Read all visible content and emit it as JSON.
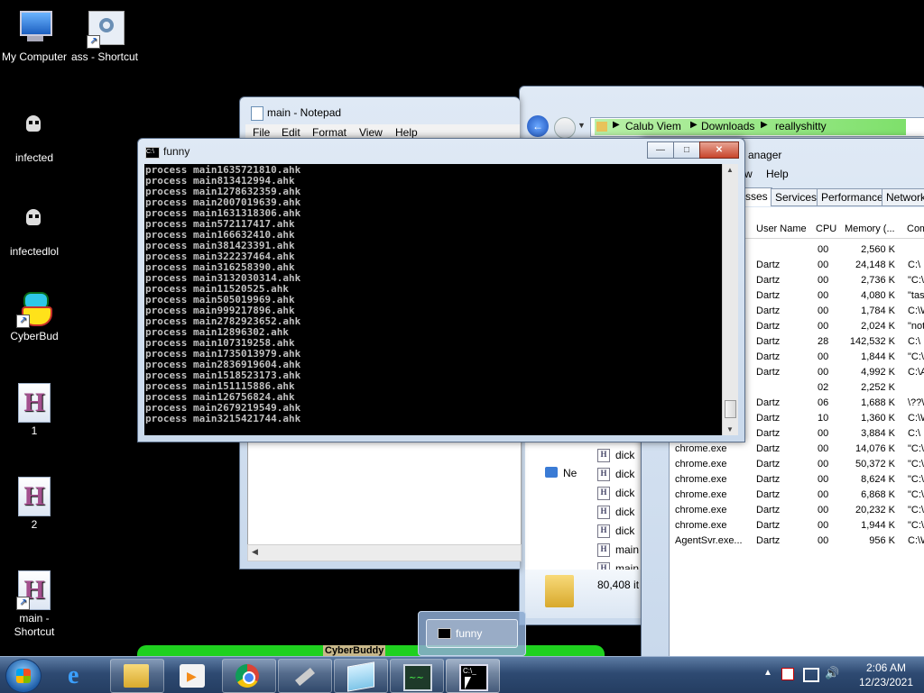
{
  "desktop": {
    "icons": [
      {
        "label": "My Computer"
      },
      {
        "label": "ass - Shortcut"
      },
      {
        "label": "infected"
      },
      {
        "label": "infectedlol"
      },
      {
        "label": "CyberBud"
      },
      {
        "label": "1"
      },
      {
        "label": "2"
      },
      {
        "label": "main - Shortcut"
      }
    ]
  },
  "notepad": {
    "title": "main - Notepad",
    "menu": [
      "File",
      "Edit",
      "Format",
      "View",
      "Help"
    ]
  },
  "explorer": {
    "breadcrumb": [
      "Calub Viem",
      "Downloads",
      "reallyshitty"
    ],
    "sidebar_network": "Ne",
    "files": [
      "dick",
      "dick",
      "dick",
      "dick",
      "dick",
      "main",
      "main"
    ],
    "status": "80,408 it"
  },
  "task_manager": {
    "title_fragment": "anager",
    "menu_fragment": [
      "w",
      "Help"
    ],
    "tabs": [
      "sses",
      "Services",
      "Performance",
      "Networki"
    ],
    "columns": [
      "User Name",
      "CPU",
      "Memory (...",
      "Com"
    ],
    "rows": [
      {
        "name": "",
        "user": "",
        "cpu": "00",
        "mem": "2,560 K",
        "cmd": ""
      },
      {
        "name": "",
        "user": "Dartz",
        "cpu": "00",
        "mem": "24,148 K",
        "cmd": "C:\\"
      },
      {
        "name": "",
        "user": "Dartz",
        "cpu": "00",
        "mem": "2,736 K",
        "cmd": "\"C:\\"
      },
      {
        "name": "",
        "user": "Dartz",
        "cpu": "00",
        "mem": "4,080 K",
        "cmd": "\"task"
      },
      {
        "name": "",
        "user": "Dartz",
        "cpu": "00",
        "mem": "1,784 K",
        "cmd": "C:\\W"
      },
      {
        "name": "",
        "user": "Dartz",
        "cpu": "00",
        "mem": "2,024 K",
        "cmd": "\"not"
      },
      {
        "name": "",
        "user": "Dartz",
        "cpu": "28",
        "mem": "142,532 K",
        "cmd": "C:\\"
      },
      {
        "name": "",
        "user": "Dartz",
        "cpu": "00",
        "mem": "1,844 K",
        "cmd": "\"C:\\"
      },
      {
        "name": "",
        "user": "Dartz",
        "cpu": "00",
        "mem": "4,992 K",
        "cmd": "C:\\A"
      },
      {
        "name": "",
        "user": "",
        "cpu": "02",
        "mem": "2,252 K",
        "cmd": ""
      },
      {
        "name": "",
        "user": "Dartz",
        "cpu": "06",
        "mem": "1,688 K",
        "cmd": "\\??\\"
      },
      {
        "name": "",
        "user": "Dartz",
        "cpu": "10",
        "mem": "1,360 K",
        "cmd": "C:\\W"
      },
      {
        "name": "",
        "user": "Dartz",
        "cpu": "00",
        "mem": "3,884 K",
        "cmd": "C:\\"
      },
      {
        "name": "chrome.exe",
        "user": "Dartz",
        "cpu": "00",
        "mem": "14,076 K",
        "cmd": "\"C:\\"
      },
      {
        "name": "chrome.exe",
        "user": "Dartz",
        "cpu": "00",
        "mem": "50,372 K",
        "cmd": "\"C:\\"
      },
      {
        "name": "chrome.exe",
        "user": "Dartz",
        "cpu": "00",
        "mem": "8,624 K",
        "cmd": "\"C:\\"
      },
      {
        "name": "chrome.exe",
        "user": "Dartz",
        "cpu": "00",
        "mem": "6,868 K",
        "cmd": "\"C:\\"
      },
      {
        "name": "chrome.exe",
        "user": "Dartz",
        "cpu": "00",
        "mem": "20,232 K",
        "cmd": "\"C:\\"
      },
      {
        "name": "chrome.exe",
        "user": "Dartz",
        "cpu": "00",
        "mem": "1,944 K",
        "cmd": "\"C:\\"
      },
      {
        "name": "AgentSvr.exe...",
        "user": "Dartz",
        "cpu": "00",
        "mem": "956 K",
        "cmd": "C:\\W"
      }
    ]
  },
  "console": {
    "title": "funny",
    "lines": [
      "process main1635721810.ahk",
      "process main813412994.ahk",
      "process main1278632359.ahk",
      "process main2007019639.ahk",
      "process main1631318306.ahk",
      "process main572117417.ahk",
      "process main166632410.ahk",
      "process main381423391.ahk",
      "process main322237464.ahk",
      "process main316258390.ahk",
      "process main3132030314.ahk",
      "process main11520525.ahk",
      "process main505019969.ahk",
      "process main999217896.ahk",
      "process main2782923652.ahk",
      "process main12896302.ahk",
      "process main107319258.ahk",
      "process main1735013979.ahk",
      "process main2836919604.ahk",
      "process main1518523173.ahk",
      "process main151115886.ahk",
      "process main126756824.ahk",
      "process main2679219549.ahk",
      "process main3215421744.ahk"
    ]
  },
  "cyberbuddy_window": {
    "title_fragment": "CyberBuddy"
  },
  "taskbar": {
    "thumbnail_label": "funny",
    "clock_time": "2:06 AM",
    "clock_date": "12/23/2021"
  },
  "colors": {
    "desktop": "#000000",
    "console_text": "#c0c0c0",
    "taskbar": "#2e4a72",
    "breadcrumb_highlight": "#7ee06b",
    "cyberbuddy_green": "#1fd11f"
  }
}
